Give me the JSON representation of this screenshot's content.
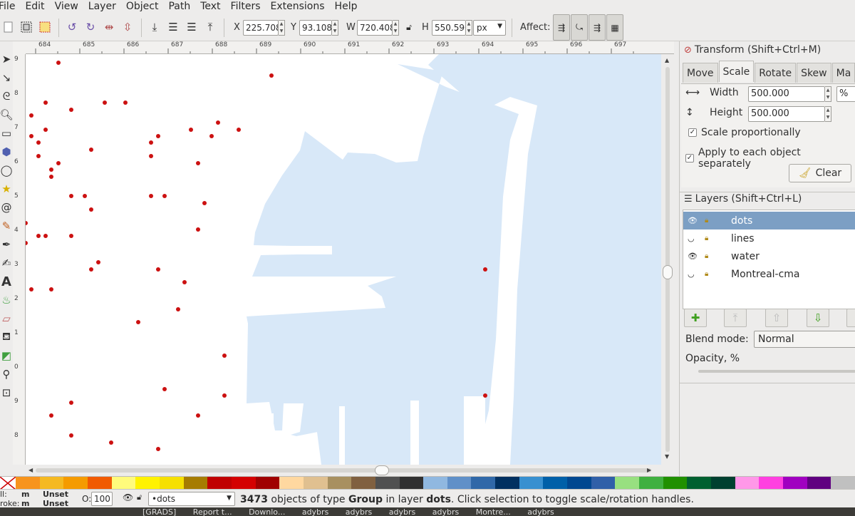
{
  "menu": [
    "File",
    "Edit",
    "View",
    "Layer",
    "Object",
    "Path",
    "Text",
    "Filters",
    "Extensions",
    "Help"
  ],
  "toolctrl": {
    "x_label": "X",
    "x_value": "225.708",
    "y_label": "Y",
    "y_value": "93.108",
    "w_label": "W",
    "w_value": "720.408",
    "h_label": "H",
    "h_value": "550.590",
    "unit": "px",
    "affect_label": "Affect:"
  },
  "ruler": {
    "h_ticks": [
      "684",
      "685",
      "686",
      "687",
      "688",
      "689",
      "690",
      "691",
      "692",
      "693",
      "694",
      "695",
      "696",
      "697"
    ],
    "v_ticks": [
      "9",
      "8",
      "7",
      "6",
      "5",
      "4",
      "3",
      "2",
      "1",
      "0",
      "9",
      "8"
    ]
  },
  "transform": {
    "title": "Transform (Shift+Ctrl+M)",
    "tabs": [
      "Move",
      "Scale",
      "Rotate",
      "Skew",
      "Ma"
    ],
    "active_tab": "Scale",
    "width_label": "Width",
    "width_value": "500.000",
    "height_label": "Height",
    "height_value": "500.000",
    "unit": "%",
    "scale_prop_label": "Scale proportionally",
    "apply_each_label": "Apply to each object separately",
    "clear_label": "Clear"
  },
  "layers": {
    "title": "Layers (Shift+Ctrl+L)",
    "items": [
      {
        "name": "dots"
      },
      {
        "name": "lines"
      },
      {
        "name": "water"
      },
      {
        "name": "Montreal-cma"
      }
    ],
    "selected": "dots",
    "blend_label": "Blend mode:",
    "blend_value": "Normal",
    "opacity_label": "Opacity, %"
  },
  "palette": [
    "#f7941d",
    "#f5b921",
    "#f59b00",
    "#f15a00",
    "#fffb7c",
    "#fff200",
    "#f6e000",
    "#a67c00",
    "#c00000",
    "#d40000",
    "#a00000",
    "#ffd8a0",
    "#e0c090",
    "#a89060",
    "#806040",
    "#505050",
    "#303030",
    "#90b8e0",
    "#6090c8",
    "#3068a8",
    "#003060",
    "#3890d0",
    "#0060a8",
    "#004890",
    "#3060a8",
    "#98e080",
    "#40b040",
    "#209000",
    "#006030",
    "#004030",
    "#ff98e8",
    "#ff40e0",
    "#a000c0",
    "#600080",
    "#c0c0c0"
  ],
  "status": {
    "fill_label": "ll:",
    "fill_value": "m",
    "fill_text": "Unset",
    "stroke_label": "roke:",
    "stroke_value": "m",
    "stroke_text": "Unset",
    "opacity_label": "O:",
    "opacity_value": "100",
    "layer_value": "•dots",
    "msg_count": "3473",
    "msg_a": " objects of type ",
    "msg_type": "Group",
    "msg_b": " in layer ",
    "msg_layer": "dots",
    "msg_c": ". Click selection to toggle scale/rotation handles."
  },
  "taskbar": [
    "[GRADS]",
    "Report t...",
    "Downlo...",
    "adybrs",
    "adybrs",
    "adybrs",
    "adybrs",
    "Montre...",
    "adybrs"
  ],
  "colors": {
    "water": "#d8e8f8",
    "dot": "#cc1111",
    "selected_layer": "#7c9fc4"
  },
  "icons": {
    "toolbox": [
      "selector-icon",
      "node-icon",
      "tweak-icon",
      "zoom-icon",
      "rect-icon",
      "box3d-icon",
      "ellipse-icon",
      "star-icon",
      "spiral-icon",
      "pencil-icon",
      "pen-icon",
      "calligraphy-icon",
      "text-icon",
      "spray-icon",
      "eraser-icon",
      "bucket-icon",
      "gradient-icon",
      "dropper-icon",
      "connector-icon"
    ]
  }
}
